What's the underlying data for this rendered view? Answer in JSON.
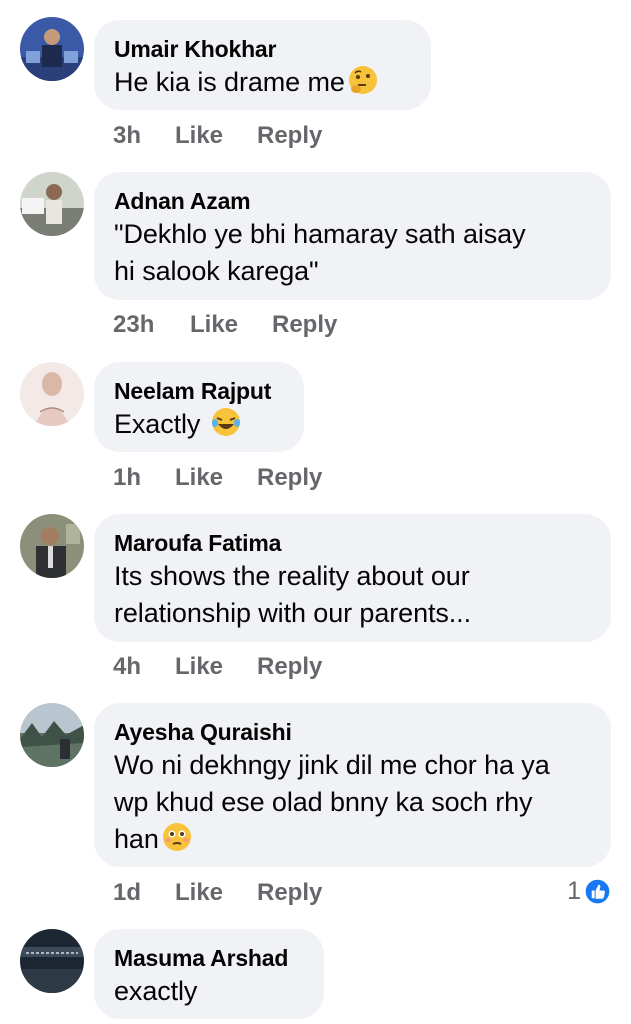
{
  "comments": [
    {
      "author": "Umair Khokhar",
      "text": "He kia is drame me",
      "emoji": "thinking-face-icon",
      "time": "3h",
      "like": "Like",
      "reply": "Reply"
    },
    {
      "author": "Adnan Azam",
      "text_lines": [
        "\"Dekhlo ye bhi hamaray sath aisay",
        "hi salook karega\""
      ],
      "time": "23h",
      "like": "Like",
      "reply": "Reply"
    },
    {
      "author": "Neelam Rajput",
      "text": "Exactly",
      "emoji": "laughing-tears-face-icon",
      "time": "1h",
      "like": "Like",
      "reply": "Reply"
    },
    {
      "author": "Maroufa Fatima",
      "text_lines": [
        "Its shows the reality about our",
        "relationship with our parents..."
      ],
      "time": "4h",
      "like": "Like",
      "reply": "Reply"
    },
    {
      "author": "Ayesha Quraishi",
      "text_lines": [
        "Wo ni dekhngy jink dil me chor ha ya",
        "wp khud ese olad bnny ka soch rhy",
        "han"
      ],
      "emoji": "flushed-face-icon",
      "time": "1d",
      "like": "Like",
      "reply": "Reply",
      "reaction_count": "1"
    },
    {
      "author": "Masuma Arshad",
      "text": "exactly"
    }
  ],
  "colors": {
    "bubble": "#f0f2f5",
    "meta": "#65676b",
    "like_blue": "#1877f2"
  }
}
